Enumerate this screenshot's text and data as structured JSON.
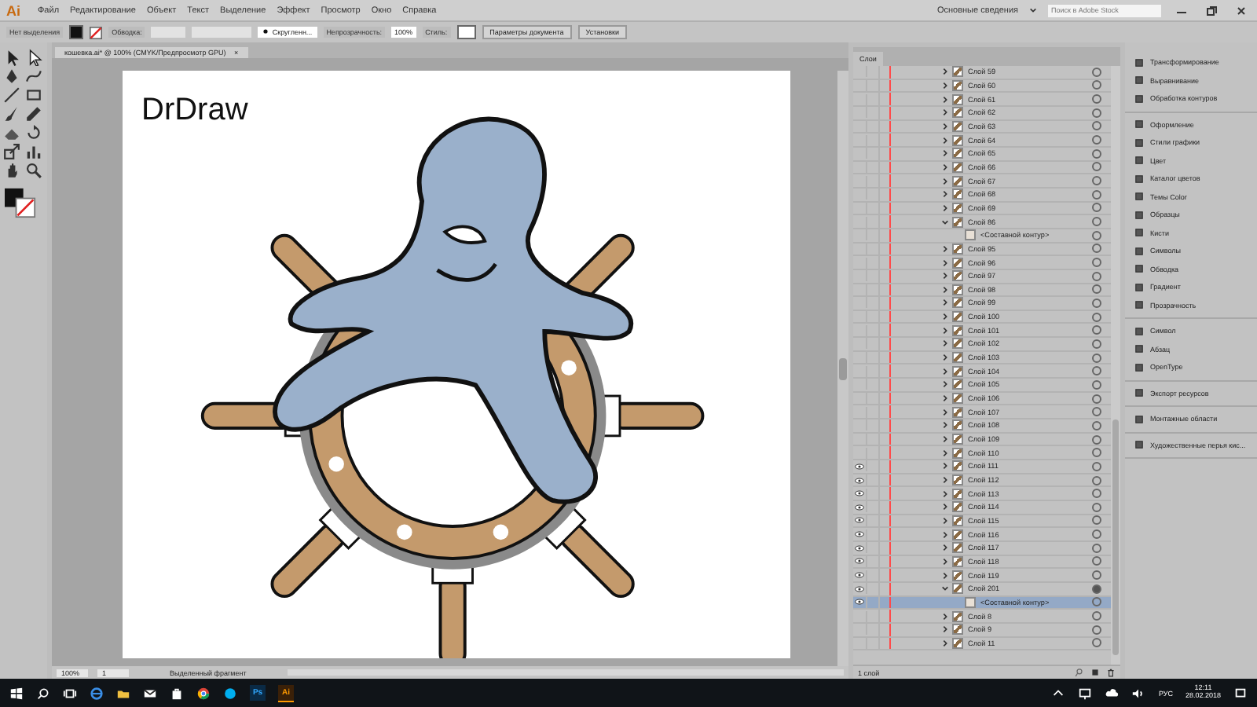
{
  "app_logo": "Ai",
  "menu": [
    "Файл",
    "Редактирование",
    "Объект",
    "Текст",
    "Выделение",
    "Эффект",
    "Просмотр",
    "Окно",
    "Справка"
  ],
  "workspace": "Основные сведения",
  "stock_search": {
    "placeholder": "Поиск в Adobe Stock"
  },
  "control_bar": {
    "selection": "Нет выделения",
    "stroke_label": "Обводка:",
    "brush": "Скругленн...",
    "opacity_label": "Непрозрачность:",
    "opacity": "100%",
    "style_label": "Стиль:",
    "doc_settings": "Параметры документа",
    "preferences": "Установки"
  },
  "document_tab": {
    "title": "кошевка.ai* @ 100% (CMYK/Предпросмотр GPU)",
    "close": "×"
  },
  "artboard_title": "DrDraw",
  "status_bar": {
    "zoom": "100%",
    "artboard": "1",
    "tool": "Выделенный фрагмент"
  },
  "layers_panel": {
    "tab": "Слои",
    "footer": "1 слой",
    "layers": [
      {
        "name": "Слой 59",
        "visible": false,
        "expanded": false,
        "selected": false,
        "targeted": false
      },
      {
        "name": "Слой 60",
        "visible": false,
        "expanded": false,
        "selected": false,
        "targeted": false
      },
      {
        "name": "Слой 61",
        "visible": false,
        "expanded": false,
        "selected": false,
        "targeted": false
      },
      {
        "name": "Слой 62",
        "visible": false,
        "expanded": false,
        "selected": false,
        "targeted": false
      },
      {
        "name": "Слой 63",
        "visible": false,
        "expanded": false,
        "selected": false,
        "targeted": false
      },
      {
        "name": "Слой 64",
        "visible": false,
        "expanded": false,
        "selected": false,
        "targeted": false
      },
      {
        "name": "Слой 65",
        "visible": false,
        "expanded": false,
        "selected": false,
        "targeted": false
      },
      {
        "name": "Слой 66",
        "visible": false,
        "expanded": false,
        "selected": false,
        "targeted": false
      },
      {
        "name": "Слой 67",
        "visible": false,
        "expanded": false,
        "selected": false,
        "targeted": false
      },
      {
        "name": "Слой 68",
        "visible": false,
        "expanded": false,
        "selected": false,
        "targeted": false
      },
      {
        "name": "Слой 69",
        "visible": false,
        "expanded": false,
        "selected": false,
        "targeted": false
      },
      {
        "name": "Слой 86",
        "visible": false,
        "expanded": true,
        "selected": false,
        "targeted": false,
        "children": [
          {
            "name": "<Составной контур>",
            "visible": false,
            "selected": false,
            "targeted": false
          }
        ]
      },
      {
        "name": "Слой 95",
        "visible": false,
        "expanded": false,
        "selected": false,
        "targeted": false
      },
      {
        "name": "Слой 96",
        "visible": false,
        "expanded": false,
        "selected": false,
        "targeted": false
      },
      {
        "name": "Слой 97",
        "visible": false,
        "expanded": false,
        "selected": false,
        "targeted": false
      },
      {
        "name": "Слой 98",
        "visible": false,
        "expanded": false,
        "selected": false,
        "targeted": false
      },
      {
        "name": "Слой 99",
        "visible": false,
        "expanded": false,
        "selected": false,
        "targeted": false
      },
      {
        "name": "Слой 100",
        "visible": false,
        "expanded": false,
        "selected": false,
        "targeted": false
      },
      {
        "name": "Слой 101",
        "visible": false,
        "expanded": false,
        "selected": false,
        "targeted": false
      },
      {
        "name": "Слой 102",
        "visible": false,
        "expanded": false,
        "selected": false,
        "targeted": false
      },
      {
        "name": "Слой 103",
        "visible": false,
        "expanded": false,
        "selected": false,
        "targeted": false
      },
      {
        "name": "Слой 104",
        "visible": false,
        "expanded": false,
        "selected": false,
        "targeted": false
      },
      {
        "name": "Слой 105",
        "visible": false,
        "expanded": false,
        "selected": false,
        "targeted": false
      },
      {
        "name": "Слой 106",
        "visible": false,
        "expanded": false,
        "selected": false,
        "targeted": false
      },
      {
        "name": "Слой 107",
        "visible": false,
        "expanded": false,
        "selected": false,
        "targeted": false
      },
      {
        "name": "Слой 108",
        "visible": false,
        "expanded": false,
        "selected": false,
        "targeted": false
      },
      {
        "name": "Слой 109",
        "visible": false,
        "expanded": false,
        "selected": false,
        "targeted": false
      },
      {
        "name": "Слой 110",
        "visible": false,
        "expanded": false,
        "selected": false,
        "targeted": false
      },
      {
        "name": "Слой 111",
        "visible": true,
        "expanded": false,
        "selected": false,
        "targeted": false
      },
      {
        "name": "Слой 112",
        "visible": true,
        "expanded": false,
        "selected": false,
        "targeted": false
      },
      {
        "name": "Слой 113",
        "visible": true,
        "expanded": false,
        "selected": false,
        "targeted": false
      },
      {
        "name": "Слой 114",
        "visible": true,
        "expanded": false,
        "selected": false,
        "targeted": false
      },
      {
        "name": "Слой 115",
        "visible": true,
        "expanded": false,
        "selected": false,
        "targeted": false
      },
      {
        "name": "Слой 116",
        "visible": true,
        "expanded": false,
        "selected": false,
        "targeted": false
      },
      {
        "name": "Слой 117",
        "visible": true,
        "expanded": false,
        "selected": false,
        "targeted": false
      },
      {
        "name": "Слой 118",
        "visible": true,
        "expanded": false,
        "selected": false,
        "targeted": false
      },
      {
        "name": "Слой 119",
        "visible": true,
        "expanded": false,
        "selected": false,
        "targeted": false
      },
      {
        "name": "Слой 201",
        "visible": true,
        "expanded": true,
        "selected": false,
        "targeted": true,
        "children": [
          {
            "name": "<Составной контур>",
            "visible": true,
            "selected": true,
            "targeted": false
          }
        ]
      },
      {
        "name": "Слой 8",
        "visible": false,
        "expanded": false,
        "selected": false,
        "targeted": false
      },
      {
        "name": "Слой 9",
        "visible": false,
        "expanded": false,
        "selected": false,
        "targeted": false
      },
      {
        "name": "Слой 11",
        "visible": false,
        "expanded": false,
        "selected": false,
        "targeted": false
      }
    ]
  },
  "panels": [
    [
      "Трансформирование",
      "Выравнивание",
      "Обработка контуров"
    ],
    [
      "Оформление",
      "Стили графики",
      "Цвет",
      "Каталог цветов",
      "Темы Color",
      "Образцы",
      "Кисти",
      "Символы",
      "Обводка",
      "Градиент",
      "Прозрачность"
    ],
    [
      "Символ",
      "Абзац",
      "OpenType"
    ],
    [
      "Экспорт ресурсов"
    ],
    [
      "Монтажные области"
    ],
    [
      "Художественные перья кис..."
    ]
  ],
  "taskbar": {
    "ps": "Ps",
    "ai": "Ai",
    "language": "РУС",
    "time": "12:11",
    "date": "28.02.2018"
  }
}
